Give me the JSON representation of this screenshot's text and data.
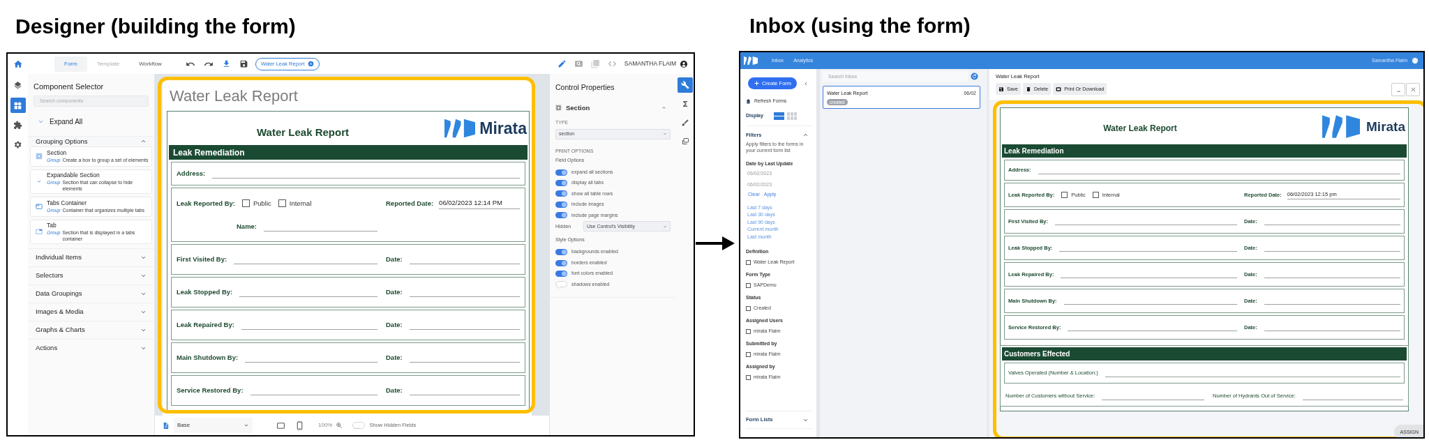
{
  "designer": {
    "heading": "Designer (building the form)",
    "tabs": [
      {
        "label": "Form",
        "selected": true,
        "disabled": false
      },
      {
        "label": "Template",
        "selected": false,
        "disabled": true
      },
      {
        "label": "Workflow",
        "selected": false,
        "disabled": false
      }
    ],
    "document_chip": "Water Leak Report",
    "user": "SAMANTHA FLAIM",
    "rail": [
      {
        "kind": "layers",
        "selected": false
      },
      {
        "kind": "widgets",
        "selected": true
      },
      {
        "kind": "puzzle",
        "selected": false
      },
      {
        "kind": "settings",
        "selected": false
      }
    ],
    "component_selector": {
      "title": "Component Selector",
      "search_placeholder": "Search components",
      "expand_all": "Expand All",
      "groups": [
        {
          "label": "Grouping Options",
          "expanded": true,
          "items": [
            {
              "kind": "section",
              "title": "Section",
              "tag": "Group",
              "description": "Create a box to group a set of elements"
            },
            {
              "kind": "expandable",
              "title": "Expandable Section",
              "tag": "Group",
              "description": "Section that can collapse to hide elements"
            },
            {
              "kind": "tabs",
              "title": "Tabs Container",
              "tag": "Group",
              "description": "Container that organizes multiple tabs"
            },
            {
              "kind": "tab",
              "title": "Tab",
              "tag": "Group",
              "description": "Section that is displayed in a tabs container"
            }
          ]
        },
        {
          "label": "Individual Items",
          "expanded": false
        },
        {
          "label": "Selectors",
          "expanded": false
        },
        {
          "label": "Data Groupings",
          "expanded": false
        },
        {
          "label": "Images & Media",
          "expanded": false
        },
        {
          "label": "Graphs & Charts",
          "expanded": false
        },
        {
          "label": "Actions",
          "expanded": false
        }
      ]
    },
    "page_title": "Water Leak Report",
    "form": {
      "title": "Water Leak Report",
      "logo_text": "Mirata",
      "sections": [
        {
          "title": "Leak Remediation",
          "rows": [
            {
              "kind": "field",
              "label": "Address:"
            },
            {
              "kind": "reported",
              "label": "Leak Reported By:",
              "options": [
                {
                  "label": "Public",
                  "checked": false
                },
                {
                  "label": "Internal",
                  "checked": false
                }
              ],
              "date_label": "Reported Date:",
              "date_value": "06/02/2023 12:14 PM",
              "name_label": "Name:"
            },
            {
              "kind": "pair",
              "label": "First Visited By:",
              "date_label": "Date:"
            },
            {
              "kind": "pair",
              "label": "Leak Stopped By:",
              "date_label": "Date:"
            },
            {
              "kind": "pair",
              "label": "Leak Repaired By:",
              "date_label": "Date:"
            },
            {
              "kind": "pair",
              "label": "Main Shutdown By:",
              "date_label": "Date:"
            },
            {
              "kind": "pair",
              "label": "Service Restored By:",
              "date_label": "Date:"
            }
          ]
        }
      ]
    },
    "bottom_bar": {
      "view": "Base",
      "zoom": "100%",
      "show_hidden": {
        "label": "Show Hidden Fields",
        "on": false
      }
    },
    "properties": {
      "title": "Control Properties",
      "section": "Section",
      "type_label": "TYPE",
      "type_value": "section",
      "print_options_label": "PRINT OPTIONS",
      "field_options_label": "Field Options",
      "field_options": [
        {
          "label": "expand all sections",
          "on": true
        },
        {
          "label": "display all tabs",
          "on": true
        },
        {
          "label": "show all table rows",
          "on": true
        },
        {
          "label": "include images",
          "on": true
        },
        {
          "label": "include page margins",
          "on": true
        }
      ],
      "hidden_label": "Hidden",
      "hidden_value": "Use Control's Visibility",
      "style_options_label": "Style Options",
      "style_options": [
        {
          "label": "backgrounds enabled",
          "on": true
        },
        {
          "label": "borders enabled",
          "on": true
        },
        {
          "label": "font colors enabled",
          "on": true
        },
        {
          "label": "shadows enabled",
          "on": false
        }
      ]
    },
    "properties_rail": [
      {
        "kind": "wrench",
        "selected": true
      },
      {
        "kind": "sigma",
        "selected": false
      },
      {
        "kind": "brush",
        "selected": false
      },
      {
        "kind": "copy",
        "selected": false
      }
    ]
  },
  "inbox": {
    "heading": "Inbox (using the form)",
    "nav": [
      {
        "label": "Inbox"
      },
      {
        "label": "Analytics"
      }
    ],
    "user": "Samantha Flaim",
    "sidebar": {
      "create_button": "Create Form",
      "refresh": "Refresh Forms",
      "display_label": "Display",
      "display_modes": [
        {
          "kind": "list",
          "selected": true
        },
        {
          "kind": "grid",
          "selected": false
        }
      ],
      "filters": {
        "title": "Filters",
        "expanded": true,
        "description": "Apply filters to the forms in your current form list",
        "date_title": "Date by Last Update",
        "date_from": "06/02/2023",
        "date_to": "06/02/2023",
        "actions": [
          "Clear",
          "Apply"
        ],
        "quick_ranges": [
          "Last 7 days",
          "Last 30 days",
          "Last 90 days",
          "Current month",
          "Last month"
        ],
        "groups": [
          {
            "title": "Definition",
            "options": [
              {
                "label": "Water Leak Report",
                "checked": false
              }
            ]
          },
          {
            "title": "Form Type",
            "options": [
              {
                "label": "SAPDemo",
                "checked": false
              }
            ]
          },
          {
            "title": "Status",
            "options": [
              {
                "label": "Created",
                "checked": false
              }
            ]
          },
          {
            "title": "Assigned Users",
            "options": [
              {
                "label": "mirata Flaim",
                "checked": false
              }
            ]
          },
          {
            "title": "Submitted by",
            "options": [
              {
                "label": "mirata Flaim",
                "checked": false
              }
            ]
          },
          {
            "title": "Assigned by",
            "options": [
              {
                "label": "mirata Flaim",
                "checked": false
              }
            ]
          }
        ]
      },
      "form_lists": {
        "title": "Form Lists",
        "expanded": false
      }
    },
    "list": {
      "search_placeholder": "Search Inbox",
      "items": [
        {
          "title": "Water Leak Report",
          "date": "06/02",
          "status": "created",
          "selected": true
        }
      ]
    },
    "document": {
      "title": "Water Leak Report",
      "actions": [
        {
          "kind": "save",
          "label": "Save"
        },
        {
          "kind": "delete",
          "label": "Delete"
        },
        {
          "kind": "print",
          "label": "Print Or Download"
        }
      ],
      "form": {
        "title": "Water Leak Report",
        "logo_text": "Mirata",
        "sections": [
          {
            "title": "Leak Remediation",
            "rows": [
              {
                "kind": "field",
                "label": "Address:"
              },
              {
                "kind": "reported",
                "label": "Leak Reported By:",
                "options": [
                  {
                    "label": "Public",
                    "checked": false
                  },
                  {
                    "label": "Internal",
                    "checked": false
                  }
                ],
                "date_label": "Reported Date:",
                "date_value": "06/02/2023 12:15 pm"
              },
              {
                "kind": "pair",
                "label": "First Visited By:",
                "date_label": "Date:"
              },
              {
                "kind": "pair",
                "label": "Leak Stopped By:",
                "date_label": "Date:"
              },
              {
                "kind": "pair",
                "label": "Leak Repaired By:",
                "date_label": "Date:"
              },
              {
                "kind": "pair",
                "label": "Main Shutdown By:",
                "date_label": "Date:"
              },
              {
                "kind": "pair",
                "label": "Service Restored By:",
                "date_label": "Date:"
              }
            ]
          },
          {
            "title": "Customers Effected",
            "rows": [
              {
                "kind": "text_field",
                "label": "Valves Operated (Number & Location:)"
              },
              {
                "kind": "text_pair",
                "label": "Number of Customers without Service:",
                "second_label": "Number of Hydrants Out of Service:"
              }
            ]
          }
        ]
      },
      "assign": "ASSIGN"
    }
  }
}
